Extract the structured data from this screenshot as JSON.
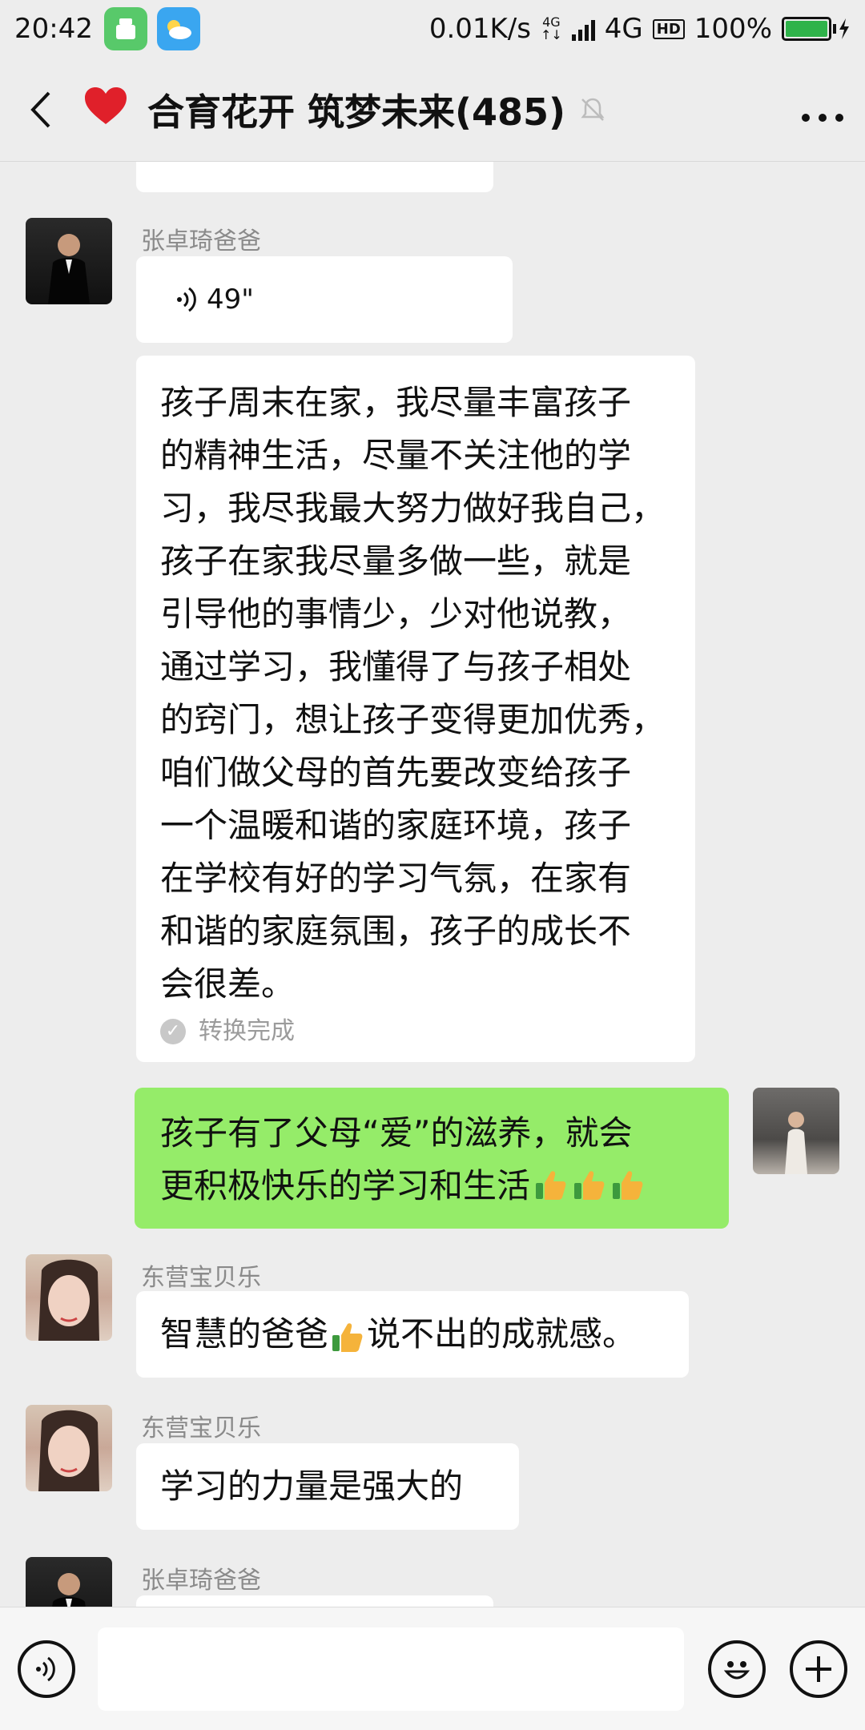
{
  "status": {
    "time": "20:42",
    "speed": "0.01K/s",
    "net_top": "4G",
    "net_bottom": "↑↓",
    "network": "4G",
    "hd": "HD",
    "battery": "100%"
  },
  "header": {
    "title": "合育花开 筑梦未来(485)",
    "heart_icon": "heart-icon",
    "more": "•••"
  },
  "messages": [
    {
      "sender": "张卓琦爸爸",
      "voice_duration": "49\"",
      "transcript": "孩子周末在家，我尽量丰富孩子的精神生活，尽量不关注他的学习，我尽我最大努力做好我自己，孩子在家我尽量多做一些，就是引导他的事情少，少对他说教，通过学习，我懂得了与孩子相处的窍门，想让孩子变得更加优秀，咱们做父母的首先要改变给孩子一个温暖和谐的家庭环境，孩子在学校有好的学习气氛，在家有和谐的家庭氛围，孩子的成长不会很差。",
      "transcript_lines": [
        "孩子周末在家，我尽量丰富孩子",
        "的精神生活，尽量不关注他的学",
        "习，我尽我最大努力做好我自己，",
        "孩子在家我尽量多做一些，就是",
        "引导他的事情少，少对他说教，",
        "通过学习，我懂得了与孩子相处",
        "的窍门，想让孩子变得更加优秀，",
        "咱们做父母的首先要改变给孩子",
        "一个温暖和谐的家庭环境，孩子",
        "在学校有好的学习气氛，在家有",
        "和谐的家庭氛围，孩子的成长不",
        "会很差。"
      ],
      "convert_status": "转换完成"
    },
    {
      "self": true,
      "line1": "孩子有了父母“爱”的滋养，就会",
      "line2": "更积极快乐的学习和生活"
    },
    {
      "sender": "东营宝贝乐",
      "text_before": "智慧的爸爸",
      "text_after": "说不出的成就感。"
    },
    {
      "sender": "东营宝贝乐",
      "text": "学习的力量是强大的"
    },
    {
      "sender": "张卓琦爸爸"
    }
  ],
  "colors": {
    "background": "#ededed",
    "self_bubble": "#95ec69",
    "other_bubble": "#ffffff",
    "heart": "#e0202a",
    "battery": "#2fb34a"
  }
}
